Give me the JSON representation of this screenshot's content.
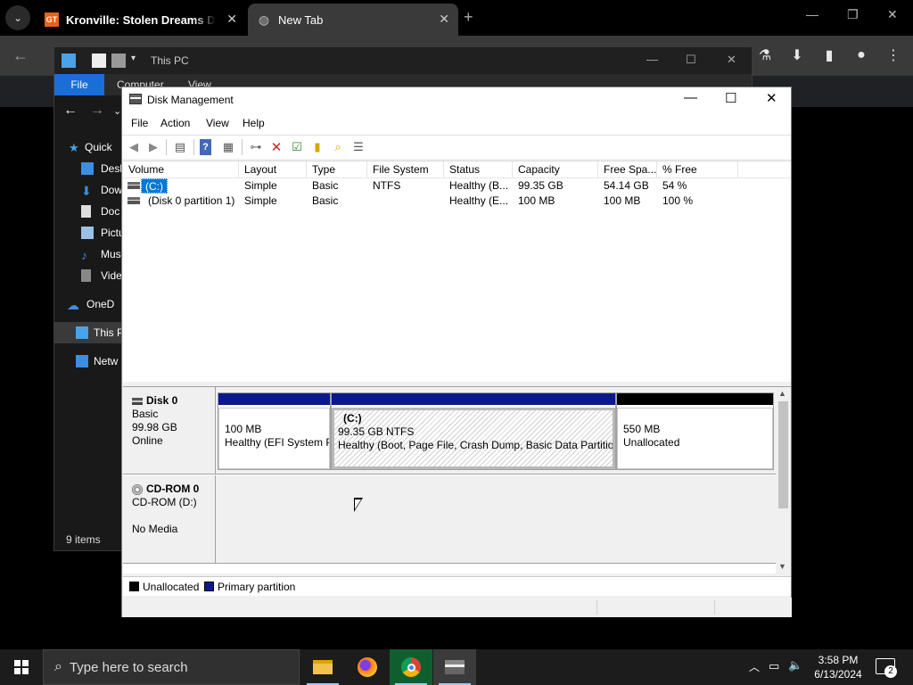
{
  "browser": {
    "tabs": [
      {
        "title": "Kronville: Stolen Dreams Down",
        "favicon": "GT"
      },
      {
        "title": "New Tab"
      }
    ]
  },
  "explorer": {
    "title": "This PC",
    "ribbon": {
      "file": "File",
      "tabs": [
        "Computer",
        "View"
      ]
    },
    "sidebar": [
      {
        "label": "Quick",
        "icon": "star-icon",
        "selected": false
      },
      {
        "label": "Desk",
        "icon": "desktop-icon",
        "selected": false
      },
      {
        "label": "Dow",
        "icon": "download-icon",
        "selected": false
      },
      {
        "label": "Doc",
        "icon": "document-icon",
        "selected": false
      },
      {
        "label": "Pictu",
        "icon": "pictures-icon",
        "selected": false
      },
      {
        "label": "Musi",
        "icon": "music-icon",
        "selected": false
      },
      {
        "label": "Vide",
        "icon": "video-icon",
        "selected": false
      },
      {
        "label": "OneD",
        "icon": "cloud-icon",
        "selected": false
      },
      {
        "label": "This P",
        "icon": "computer-icon",
        "selected": true
      },
      {
        "label": "Netw",
        "icon": "network-icon",
        "selected": false
      }
    ],
    "status": "9 items"
  },
  "disk_management": {
    "title": "Disk Management",
    "menu": [
      "File",
      "Action",
      "View",
      "Help"
    ],
    "columns": [
      "Volume",
      "Layout",
      "Type",
      "File System",
      "Status",
      "Capacity",
      "Free Spa...",
      "% Free"
    ],
    "volumes": [
      {
        "volume": "(C:)",
        "layout": "Simple",
        "type": "Basic",
        "fs": "NTFS",
        "status": "Healthy (B...",
        "capacity": "99.35 GB",
        "free": "54.14 GB",
        "pct": "54 %",
        "selected": true
      },
      {
        "volume": "(Disk 0 partition 1)",
        "layout": "Simple",
        "type": "Basic",
        "fs": "",
        "status": "Healthy (E...",
        "capacity": "100 MB",
        "free": "100 MB",
        "pct": "100 %",
        "selected": false
      }
    ],
    "disks": [
      {
        "name": "Disk 0",
        "kind": "Basic",
        "size": "99.98 GB",
        "state": "Online",
        "partitions": [
          {
            "title": "",
            "size": "100 MB",
            "desc": "Healthy (EFI System P",
            "band": "#0a1a8c"
          },
          {
            "title": "(C:)",
            "size": "99.35 GB NTFS",
            "desc": "Healthy (Boot, Page File, Crash Dump, Basic Data Partition",
            "band": "#0a1a8c"
          },
          {
            "title": "",
            "size": "550 MB",
            "desc": "Unallocated",
            "band": "#000000"
          }
        ]
      },
      {
        "name": "CD-ROM 0",
        "kind": "CD-ROM (D:)",
        "state": "No Media"
      }
    ],
    "legend": [
      {
        "label": "Unallocated",
        "color": "#000000"
      },
      {
        "label": "Primary partition",
        "color": "#0a1a8c"
      }
    ]
  },
  "taskbar": {
    "search_placeholder": "Type here to search",
    "time": "3:58 PM",
    "date": "6/13/2024",
    "notification_count": "2"
  }
}
